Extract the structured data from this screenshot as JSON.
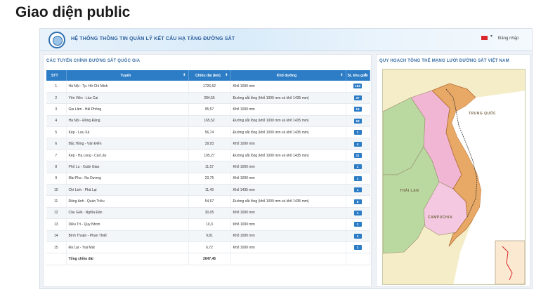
{
  "slide": {
    "title": "Giao diện public"
  },
  "header": {
    "system_title": "HỆ THỐNG THÔNG TIN QUẢN LÝ KẾT CẤU HẠ TẦNG ĐƯỜNG SẮT",
    "language_caret": "▾",
    "login_label": "Đăng nhập"
  },
  "routes_panel": {
    "heading": "CÁC TUYẾN CHÍNH ĐƯỜNG SẮT QUỐC GIA",
    "columns": [
      "STT",
      "Tuyến",
      "Chiều dài (km)",
      "Khổ đường",
      "SL khu gian"
    ],
    "sort_icon": "⬍",
    "rows": [
      {
        "stt": "1",
        "route": "Hà Nội - Tp. Hồ Chí Minh",
        "length": "1726,52",
        "gauge": "Khổ 1000 mm",
        "count": "163"
      },
      {
        "stt": "2",
        "route": "Yên Viên - Lào Cai",
        "length": "284,55",
        "gauge": "Đường sắt lồng (khổ 1000 mm và khổ 1435 mm)",
        "count": "37"
      },
      {
        "stt": "3",
        "route": "Gia Lâm - Hải Phòng",
        "length": "95,57",
        "gauge": "Khổ 1000 mm",
        "count": "14"
      },
      {
        "stt": "4",
        "route": "Hà Nội - Đồng Đăng",
        "length": "165,52",
        "gauge": "Đường sắt lồng (khổ 1000 mm và khổ 1435 mm)",
        "count": "18"
      },
      {
        "stt": "5",
        "route": "Kép - Lưu Xá",
        "length": "56,74",
        "gauge": "Đường sắt lồng (khổ 1000 mm và khổ 1435 mm)",
        "count": "1"
      },
      {
        "stt": "6",
        "route": "Bắc Hồng - Văn Điển",
        "length": "39,93",
        "gauge": "Khổ 1000 mm",
        "count": "4"
      },
      {
        "stt": "7",
        "route": "Kép - Hạ Long - Cái Lân",
        "length": "105,27",
        "gauge": "Đường sắt lồng (khổ 1000 mm và khổ 1435 mm)",
        "count": "11"
      },
      {
        "stt": "8",
        "route": "Phố Lu - Xuân Giao",
        "length": "11,57",
        "gauge": "Khổ 1000 mm",
        "count": "1"
      },
      {
        "stt": "9",
        "route": "Mai Pha - Na Dương",
        "length": "23,75",
        "gauge": "Khổ 1000 mm",
        "count": "1"
      },
      {
        "stt": "10",
        "route": "Chí Linh - Phả Lại",
        "length": "11,49",
        "gauge": "Khổ 1435 mm",
        "count": "1"
      },
      {
        "stt": "11",
        "route": "Đông Anh - Quán Triều",
        "length": "54,67",
        "gauge": "Đường sắt lồng (khổ 1000 mm và khổ 1435 mm)",
        "count": "8"
      },
      {
        "stt": "12",
        "route": "Cầu Giát - Nghĩa Đàn",
        "length": "30,05",
        "gauge": "Khổ 1000 mm",
        "count": "1"
      },
      {
        "stt": "13",
        "route": "Diêu Trì - Quy Nhơn",
        "length": "10,3",
        "gauge": "Khổ 1000 mm",
        "count": "1"
      },
      {
        "stt": "14",
        "route": "Bình Thuận - Phan Thiết",
        "length": "9,81",
        "gauge": "Khổ 1000 mm",
        "count": "1"
      },
      {
        "stt": "15",
        "route": "Đà Lạt - Trại Mát",
        "length": "6,72",
        "gauge": "Khổ 1000 mm",
        "count": "1"
      }
    ],
    "total_label": "Tổng chiều dài",
    "total_value": "2647,46"
  },
  "map_panel": {
    "heading": "QUY HOẠCH TỔNG THỂ MẠNG LƯỚI ĐƯỜNG SẮT VIỆT NAM",
    "labels": {
      "china": "TRUNG QUỐC",
      "thailand": "THÁI LAN",
      "cambodia": "CAMPUCHIA"
    },
    "colors": {
      "vietnam": "#e8a866",
      "laos": "#f0b6d3",
      "thailand": "#b9d9a0",
      "cambodia": "#f3c8e0",
      "china": "#f5ecc8",
      "sea": "#ffffff"
    }
  },
  "colors": {
    "table_header": "#2c7cc6",
    "badge": "#2c7cc6",
    "heading_text": "#3a6fa5"
  }
}
